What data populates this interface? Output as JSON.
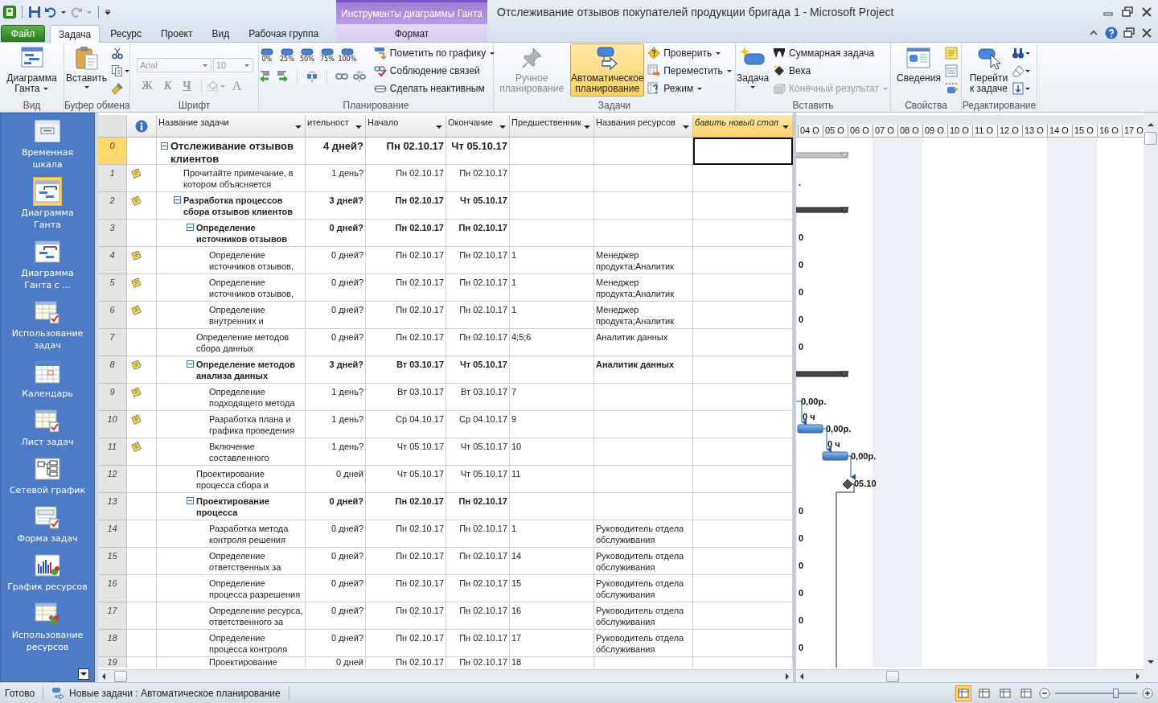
{
  "title_bar": {
    "contextual_group": "Инструменты диаграммы Ганта",
    "title": "Отслеживание отзывов покупателей продукции бригада 1  -  Microsoft Project"
  },
  "tabs": [
    {
      "label": "Файл",
      "kind": "file",
      "selected": false
    },
    {
      "label": "Задача",
      "kind": "tab",
      "selected": true
    },
    {
      "label": "Ресурс",
      "kind": "tab",
      "selected": false
    },
    {
      "label": "Проект",
      "kind": "tab",
      "selected": false
    },
    {
      "label": "Вид",
      "kind": "tab",
      "selected": false
    },
    {
      "label": "Рабочая группа",
      "kind": "tab",
      "selected": false
    },
    {
      "label": "Формат",
      "kind": "contextual",
      "selected": false
    }
  ],
  "ribbon": {
    "view": {
      "label": "Вид",
      "gantt_button": "Диаграмма Ганта"
    },
    "clipboard": {
      "label": "Буфер обмена",
      "paste_button": "Вставить"
    },
    "font": {
      "label": "Шрифт",
      "font_name": "Arial",
      "font_size": "10",
      "bold": "Ж",
      "italic": "К",
      "underline": "Ч",
      "font_color": "A",
      "disabled": true
    },
    "schedule": {
      "label": "Планирование",
      "percent_buttons": [
        "0%",
        "25%",
        "50%",
        "75%",
        "100%"
      ],
      "commands": [
        "Пометить по графику",
        "Соблюдение связей",
        "Сделать неактивным"
      ]
    },
    "tasks": {
      "label": "Задачи",
      "modes": [
        {
          "label": "Ручное планирование",
          "selected": false,
          "disabled": true
        },
        {
          "label": "Автоматическое планирование",
          "selected": true,
          "disabled": false
        }
      ],
      "commands": [
        "Проверить",
        "Переместить",
        "Режим"
      ]
    },
    "insert": {
      "label": "Вставить",
      "task_button": "Задача",
      "commands": [
        {
          "label": "Суммарная задача",
          "disabled": false
        },
        {
          "label": "Веха",
          "disabled": false
        },
        {
          "label": "Конечный результат",
          "disabled": true
        }
      ]
    },
    "properties": {
      "label": "Свойства",
      "info_button": "Сведения"
    },
    "editing": {
      "label": "Редактирование",
      "goto_button": "Перейти\nк задаче"
    }
  },
  "views": [
    {
      "label": "Временная\nшкала",
      "selected": false
    },
    {
      "label": "Диаграмма\nГанта",
      "selected": true
    },
    {
      "label": "Диаграмма\nГанта с          ...",
      "selected": false
    },
    {
      "label": "Использование\nзадач",
      "selected": false
    },
    {
      "label": "Календарь",
      "selected": false
    },
    {
      "label": "Лист задач",
      "selected": false
    },
    {
      "label": "Сетевой график",
      "selected": false
    },
    {
      "label": "Форма задач",
      "selected": false
    },
    {
      "label": "График ресурсов",
      "selected": false
    },
    {
      "label": "Использование\nресурсов",
      "selected": false
    }
  ],
  "table": {
    "columns": [
      {
        "label": "Название задачи",
        "selected": false
      },
      {
        "label": "ительност",
        "selected": false
      },
      {
        "label": "Начало",
        "selected": false
      },
      {
        "label": "Окончание",
        "selected": false
      },
      {
        "label": "Предшественник",
        "selected": false
      },
      {
        "label": "Названия ресурсов",
        "selected": false
      },
      {
        "label": "бавить новый стол",
        "selected": true
      }
    ],
    "tasks": [
      {
        "id": "0",
        "kind": "project",
        "name": "Отслеживание отзывов\nклиентов",
        "duration": "4 дней?",
        "start": "Пн 02.10.17",
        "finish": "Чт 05.10.17",
        "note": false,
        "selected": true,
        "expanded": true,
        "children": [
          {
            "id": "1",
            "kind": "task",
            "name": "Прочитайте примечание, в\nкотором объясняется",
            "duration": "1 день?",
            "start": "Пн 02.10.17",
            "finish": "Пн 02.10.17",
            "note": true,
            "selected": false,
            "bar_label": "."
          },
          {
            "id": "2",
            "kind": "summary",
            "name": "Разработка процессов\nсбора отзывов клиентов",
            "duration": "3 дней?",
            "start": "Пн 02.10.17",
            "finish": "Чт 05.10.17",
            "note": true,
            "selected": false,
            "expanded": true,
            "children": [
              {
                "id": "3",
                "kind": "summary",
                "name": "Определение\nисточников отзывов",
                "duration": "0 дней?",
                "start": "Пн 02.10.17",
                "finish": "Пн 02.10.17",
                "note": false,
                "selected": false,
                "bar_label": "0",
                "expanded": true,
                "children": [
                  {
                    "id": "4",
                    "kind": "milestone",
                    "name": "Определение\nисточников отзывов,",
                    "duration": "0 дней?",
                    "start": "Пн 02.10.17",
                    "finish": "Пн 02.10.17",
                    "predecessors": "1",
                    "resources": "Менеджер\nпродукта;Аналитик",
                    "note": true,
                    "selected": false,
                    "bar_label": "0"
                  },
                  {
                    "id": "5",
                    "kind": "milestone",
                    "name": "Определение\nисточников отзывов,",
                    "duration": "0 дней?",
                    "start": "Пн 02.10.17",
                    "finish": "Пн 02.10.17",
                    "predecessors": "1",
                    "resources": "Менеджер\nпродукта;Аналитик",
                    "note": true,
                    "selected": false,
                    "bar_label": "0"
                  },
                  {
                    "id": "6",
                    "kind": "milestone",
                    "name": "Определение\nвнутренних и",
                    "duration": "0 дней?",
                    "start": "Пн 02.10.17",
                    "finish": "Пн 02.10.17",
                    "predecessors": "1",
                    "resources": "Менеджер\nпродукта;Аналитик",
                    "note": true,
                    "selected": false,
                    "bar_label": "0"
                  }
                ]
              },
              {
                "id": "7",
                "kind": "milestone",
                "name": "Определение методов\nсбора данных",
                "duration": "0 дней?",
                "start": "Пн 02.10.17",
                "finish": "Пн 02.10.17",
                "predecessors": "4;5;6",
                "resources": "Аналитик данных",
                "note": false,
                "selected": false,
                "bar_label": "0"
              },
              {
                "id": "8",
                "kind": "summary",
                "name": "Определение методов\nанализа данных",
                "duration": "3 дней?",
                "start": "Вт 03.10.17",
                "finish": "Чт 05.10.17",
                "resources": "Аналитик данных",
                "note": true,
                "selected": false,
                "expanded": true,
                "children": [
                  {
                    "id": "9",
                    "kind": "task",
                    "name": "Определение\nподходящего метода",
                    "duration": "1 день?",
                    "start": "Вт 03.10.17",
                    "finish": "Вт 03.10.17",
                    "predecessors": "7",
                    "note": true,
                    "selected": false,
                    "bar_label": "0,00р."
                  },
                  {
                    "id": "10",
                    "kind": "task",
                    "name": "Разработка плана и\nграфика проведения",
                    "duration": "1 день?",
                    "start": "Ср 04.10.17",
                    "finish": "Ср 04.10.17",
                    "predecessors": "9",
                    "note": true,
                    "selected": false,
                    "bar_label": "0,00р.",
                    "lag_label": "0 ч"
                  },
                  {
                    "id": "11",
                    "kind": "task",
                    "name": "Включение\nсоставленного",
                    "duration": "1 день?",
                    "start": "Чт 05.10.17",
                    "finish": "Чт 05.10.17",
                    "predecessors": "10",
                    "note": true,
                    "selected": false,
                    "bar_label": "0,00р.",
                    "lag_label": "0 ч"
                  }
                ]
              },
              {
                "id": "12",
                "kind": "milestone",
                "name": "Проектирование\nпроцесса сбора и",
                "duration": "0 дней",
                "start": "Чт 05.10.17",
                "finish": "Чт 05.10.17",
                "predecessors": "11",
                "note": false,
                "selected": false,
                "bar_label": "05.10"
              },
              {
                "id": "13",
                "kind": "summary",
                "name": "Проектирование\nпроцесса",
                "duration": "0 дней?",
                "start": "Пн 02.10.17",
                "finish": "Пн 02.10.17",
                "note": false,
                "selected": false,
                "bar_label": "0",
                "expanded": true,
                "children": [
                  {
                    "id": "14",
                    "kind": "milestone",
                    "name": "Разработка метода\nконтроля решения",
                    "duration": "0 дней?",
                    "start": "Пн 02.10.17",
                    "finish": "Пн 02.10.17",
                    "predecessors": "1",
                    "resources": "Руководитель отдела\nобслуживания",
                    "note": false,
                    "selected": false,
                    "bar_label": "0"
                  },
                  {
                    "id": "15",
                    "kind": "milestone",
                    "name": "Определение\nответственных за",
                    "duration": "0 дней?",
                    "start": "Пн 02.10.17",
                    "finish": "Пн 02.10.17",
                    "predecessors": "14",
                    "resources": "Руководитель отдела\nобслуживания",
                    "note": false,
                    "selected": false,
                    "bar_label": "0"
                  },
                  {
                    "id": "16",
                    "kind": "milestone",
                    "name": "Определение\nпроцесса разрешения",
                    "duration": "0 дней?",
                    "start": "Пн 02.10.17",
                    "finish": "Пн 02.10.17",
                    "predecessors": "15",
                    "resources": "Руководитель отдела\nобслуживания",
                    "note": false,
                    "selected": false,
                    "bar_label": "0"
                  },
                  {
                    "id": "17",
                    "kind": "milestone",
                    "name": "Определение ресурса,\nответственного за",
                    "duration": "0 дней?",
                    "start": "Пн 02.10.17",
                    "finish": "Пн 02.10.17",
                    "predecessors": "16",
                    "resources": "Руководитель отдела\nобслуживания",
                    "note": false,
                    "selected": false,
                    "bar_label": "0"
                  },
                  {
                    "id": "18",
                    "kind": "milestone",
                    "name": "Определение\nпроцесса контроля",
                    "duration": "0 дней?",
                    "start": "Пн 02.10.17",
                    "finish": "Пн 02.10.17",
                    "predecessors": "17",
                    "resources": "Руководитель отдела\nобслуживания",
                    "note": false,
                    "selected": false,
                    "bar_label": "0"
                  },
                  {
                    "id": "19",
                    "kind": "milestone",
                    "name": "Проектирование",
                    "duration": "0 дней",
                    "start": "Пн 02.10.17",
                    "finish": "Пн 02.10.17",
                    "predecessors": "18",
                    "note": false,
                    "selected": false
                  }
                ]
              }
            ]
          }
        ]
      }
    ]
  },
  "gantt": {
    "timescale": [
      "04 О",
      "05 О",
      "06 О",
      "07 О",
      "08 О",
      "09 О",
      "10 О",
      "11 О",
      "12 О",
      "13 О",
      "14 О",
      "15 О",
      "16 О",
      "17 О"
    ]
  },
  "status_bar": {
    "ready": "Готово",
    "new_tasks": "Новые задачи : Автоматическое планирование",
    "views": [
      {
        "selected": true
      },
      {
        "selected": false
      },
      {
        "selected": false
      },
      {
        "selected": false
      }
    ],
    "zoom": {
      "level": 0.74
    }
  }
}
